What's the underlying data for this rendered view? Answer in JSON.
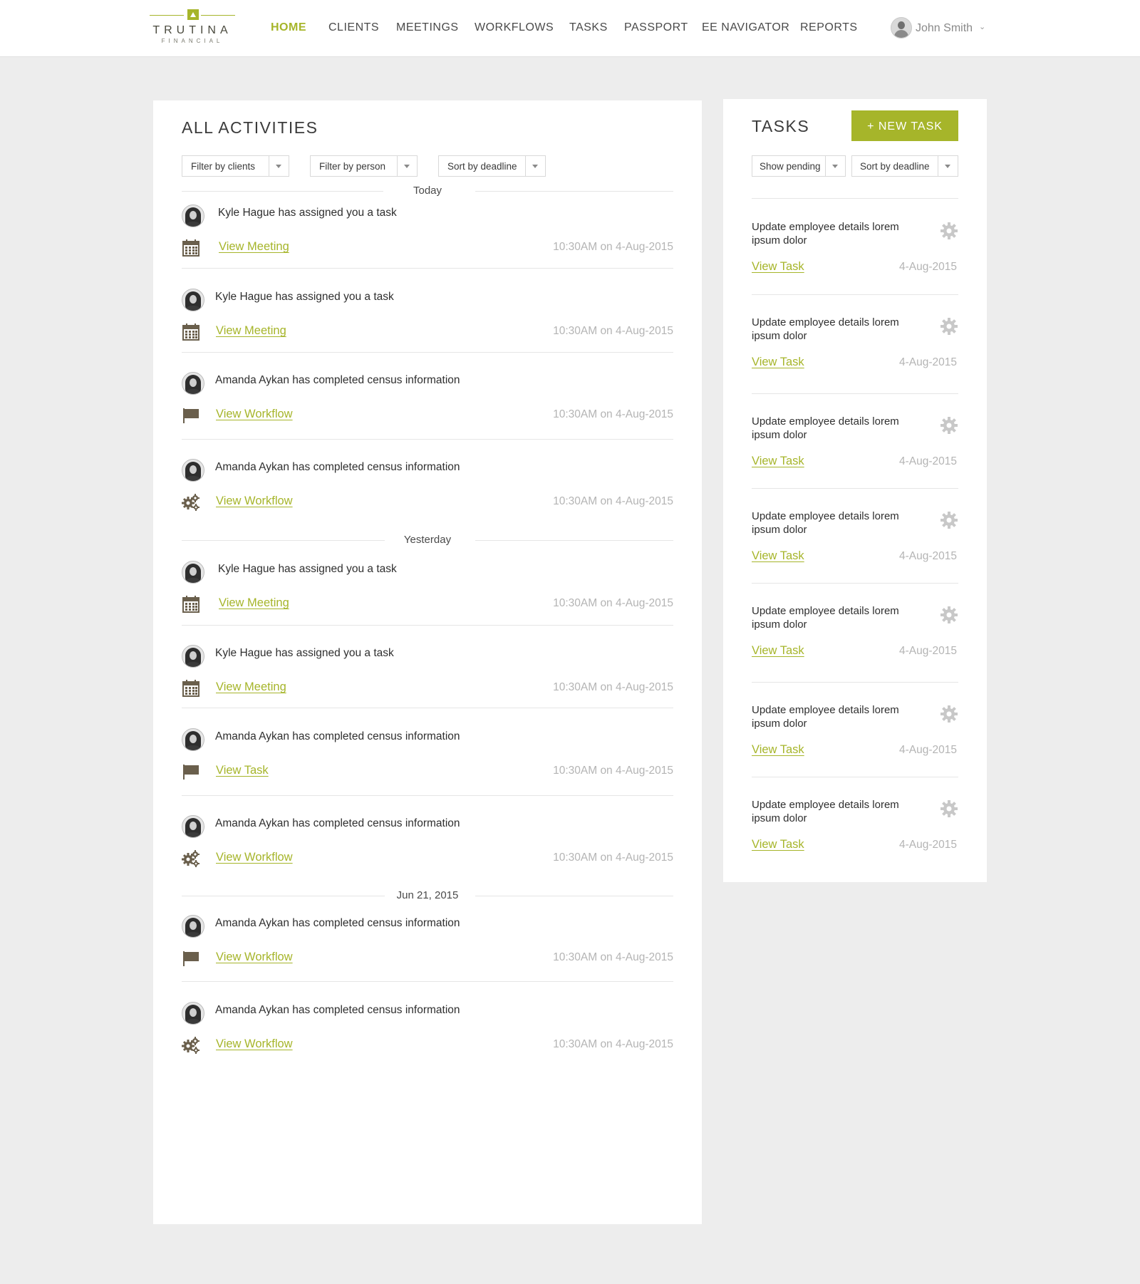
{
  "brand": {
    "name": "TRUTINA",
    "sub": "FINANCIAL",
    "accent": "#a6b52a"
  },
  "nav": {
    "items": [
      {
        "label": "HOME",
        "active": true
      },
      {
        "label": "CLIENTS"
      },
      {
        "label": "MEETINGS"
      },
      {
        "label": "WORKFLOWS"
      },
      {
        "label": "TASKS"
      },
      {
        "label": "PASSPORT"
      },
      {
        "label": "EE NAVIGATOR"
      },
      {
        "label": "REPORTS"
      }
    ],
    "user": {
      "name": "John Smith"
    }
  },
  "activities": {
    "title": "ALL ACTIVITIES",
    "filters": [
      "Filter by clients",
      "Filter by person",
      "Sort by deadline"
    ],
    "groups": [
      {
        "label": "Today",
        "items": [
          {
            "text": "Kyle Hague has assigned you a task",
            "link": "View Meeting",
            "icon": "calendar-icon",
            "time": "10:30AM on 4-Aug-2015"
          },
          {
            "text": "Kyle Hague has assigned you a task",
            "link": "View Meeting",
            "icon": "calendar-icon",
            "time": "10:30AM on 4-Aug-2015"
          },
          {
            "text": "Amanda Aykan has completed census information",
            "link": "View Workflow",
            "icon": "flag-icon",
            "time": "10:30AM on 4-Aug-2015"
          },
          {
            "text": "Amanda Aykan has completed census information",
            "link": "View Workflow",
            "icon": "gears-icon",
            "time": "10:30AM on 4-Aug-2015"
          }
        ]
      },
      {
        "label": "Yesterday",
        "items": [
          {
            "text": "Kyle Hague has assigned you a task",
            "link": "View Meeting",
            "icon": "calendar-icon",
            "time": "10:30AM on 4-Aug-2015"
          },
          {
            "text": "Kyle Hague has assigned you a task",
            "link": "View Meeting",
            "icon": "calendar-icon",
            "time": "10:30AM on 4-Aug-2015"
          },
          {
            "text": "Amanda Aykan has completed census information",
            "link": "View Task",
            "icon": "flag-icon",
            "time": "10:30AM on 4-Aug-2015"
          },
          {
            "text": "Amanda Aykan has completed census information",
            "link": "View Workflow",
            "icon": "gears-icon",
            "time": "10:30AM on 4-Aug-2015"
          }
        ]
      },
      {
        "label": "Jun 21, 2015",
        "items": [
          {
            "text": "Amanda Aykan has completed census information",
            "link": "View Workflow",
            "icon": "flag-icon",
            "time": "10:30AM on 4-Aug-2015"
          },
          {
            "text": "Amanda Aykan has completed census information",
            "link": "View Workflow",
            "icon": "gears-icon",
            "time": "10:30AM on 4-Aug-2015"
          }
        ]
      }
    ]
  },
  "tasks": {
    "title": "TASKS",
    "new_button": "+ NEW TASK",
    "filters": [
      "Show pending",
      "Sort by deadline"
    ],
    "items": [
      {
        "title": "Update employee details lorem ipsum dolor",
        "link": "View Task",
        "date": "4-Aug-2015"
      },
      {
        "title": "Update employee details lorem ipsum dolor",
        "link": "View Task",
        "date": "4-Aug-2015"
      },
      {
        "title": "Update employee details lorem ipsum dolor",
        "link": "View Task",
        "date": "4-Aug-2015"
      },
      {
        "title": "Update employee details lorem ipsum dolor",
        "link": "View Task",
        "date": "4-Aug-2015"
      },
      {
        "title": "Update employee details lorem ipsum dolor",
        "link": "View Task",
        "date": "4-Aug-2015"
      },
      {
        "title": "Update employee details lorem ipsum dolor",
        "link": "View Task",
        "date": "4-Aug-2015"
      },
      {
        "title": "Update employee details lorem ipsum dolor",
        "link": "View Task",
        "date": "4-Aug-2015"
      }
    ]
  }
}
